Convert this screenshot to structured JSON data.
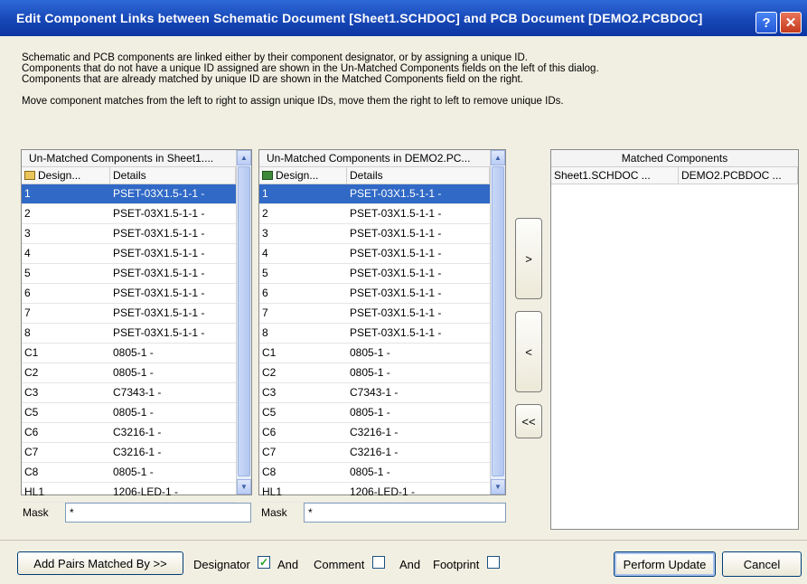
{
  "dialog": {
    "title": "Edit Component Links between Schematic Document [Sheet1.SCHDOC] and PCB Document [DEMO2.PCBDOC]",
    "help_label": "?",
    "close_label": "✕"
  },
  "intro": {
    "lines": [
      "Schematic and PCB components are linked either by their component designator, or by assigning a unique ID.",
      "Components that do not have a unique ID assigned are shown in the Un-Matched Components fields on the left of this dialog.",
      "Components that are already matched by unique ID are shown in the Matched Components field on the right."
    ],
    "note": "Move component matches from the left to right to assign unique IDs, move them the right to left to remove unique IDs."
  },
  "unmatched_sch": {
    "header": "Un-Matched Components in Sheet1....",
    "columns": [
      "Design...",
      "Details"
    ],
    "mask_label": "Mask",
    "mask_value": "*",
    "rows": [
      [
        "1",
        "PSET-03X1.5-1-1 -"
      ],
      [
        "2",
        "PSET-03X1.5-1-1 -"
      ],
      [
        "3",
        "PSET-03X1.5-1-1 -"
      ],
      [
        "4",
        "PSET-03X1.5-1-1 -"
      ],
      [
        "5",
        "PSET-03X1.5-1-1 -"
      ],
      [
        "6",
        "PSET-03X1.5-1-1 -"
      ],
      [
        "7",
        "PSET-03X1.5-1-1 -"
      ],
      [
        "8",
        "PSET-03X1.5-1-1 -"
      ],
      [
        "C1",
        "0805-1 -"
      ],
      [
        "C2",
        "0805-1 -"
      ],
      [
        "C3",
        "C7343-1 -"
      ],
      [
        "C5",
        "0805-1 -"
      ],
      [
        "C6",
        "C3216-1 -"
      ],
      [
        "C7",
        "C3216-1 -"
      ],
      [
        "C8",
        "0805-1 -"
      ],
      [
        "HL1",
        "1206-LED-1 -"
      ]
    ]
  },
  "unmatched_pcb": {
    "header": "Un-Matched Components in DEMO2.PC...",
    "columns": [
      "Design...",
      "Details"
    ],
    "mask_label": "Mask",
    "mask_value": "*",
    "rows": [
      [
        "1",
        "PSET-03X1.5-1-1 -"
      ],
      [
        "2",
        "PSET-03X1.5-1-1 -"
      ],
      [
        "3",
        "PSET-03X1.5-1-1 -"
      ],
      [
        "4",
        "PSET-03X1.5-1-1 -"
      ],
      [
        "5",
        "PSET-03X1.5-1-1 -"
      ],
      [
        "6",
        "PSET-03X1.5-1-1 -"
      ],
      [
        "7",
        "PSET-03X1.5-1-1 -"
      ],
      [
        "8",
        "PSET-03X1.5-1-1 -"
      ],
      [
        "C1",
        "0805-1 -"
      ],
      [
        "C2",
        "0805-1 -"
      ],
      [
        "C3",
        "C7343-1 -"
      ],
      [
        "C5",
        "0805-1 -"
      ],
      [
        "C6",
        "C3216-1 -"
      ],
      [
        "C7",
        "C3216-1 -"
      ],
      [
        "C8",
        "0805-1 -"
      ],
      [
        "HL1",
        "1206-LED-1 -"
      ]
    ]
  },
  "matched": {
    "header": "Matched Components",
    "columns": [
      "Sheet1.SCHDOC ...",
      "DEMO2.PCBDOC ..."
    ]
  },
  "move_buttons": {
    "add": ">",
    "remove": "<",
    "remove_all": "<<"
  },
  "footer": {
    "add_pairs": "Add Pairs Matched By >>",
    "designator_label": "Designator",
    "designator_checked": true,
    "and1": "And",
    "comment_label": "Comment",
    "comment_checked": false,
    "and2": "And",
    "footprint_label": "Footprint",
    "footprint_checked": false,
    "perform_update": "Perform Update",
    "cancel": "Cancel"
  },
  "colors": {
    "title_bar": "#1747b7",
    "selection": "#3169c6",
    "dialog_bg": "#f1efe2"
  }
}
